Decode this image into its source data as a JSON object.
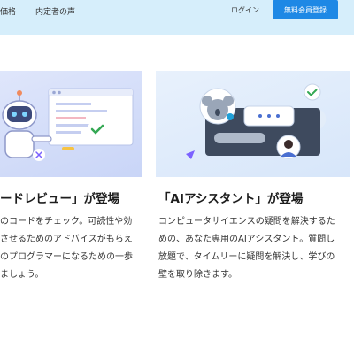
{
  "header": {
    "nav": [
      "価格",
      "内定者の声"
    ],
    "login_label": "ログイン",
    "signup_label": "無料会員登録"
  },
  "cards": [
    {
      "title": "ードレビュー」が登場",
      "body_lines": [
        "のコードをチェック。可読性や効",
        "させるためのアドバイスがもらえ",
        "のプログラマーになるための一歩",
        "ましょう。"
      ]
    },
    {
      "title": "「AIアシスタント」が登場",
      "body_lines": [
        "コンピュータサイエンスの疑問を解決するた",
        "めの、あなた専用のAIアシスタント。質問し",
        "放題で、タイムリーに疑問を解決し、学びの",
        "壁を取り除きます。"
      ]
    }
  ],
  "colors": {
    "header_bg": "#d6eefb",
    "signup_button_bg": "#1e88e5"
  }
}
